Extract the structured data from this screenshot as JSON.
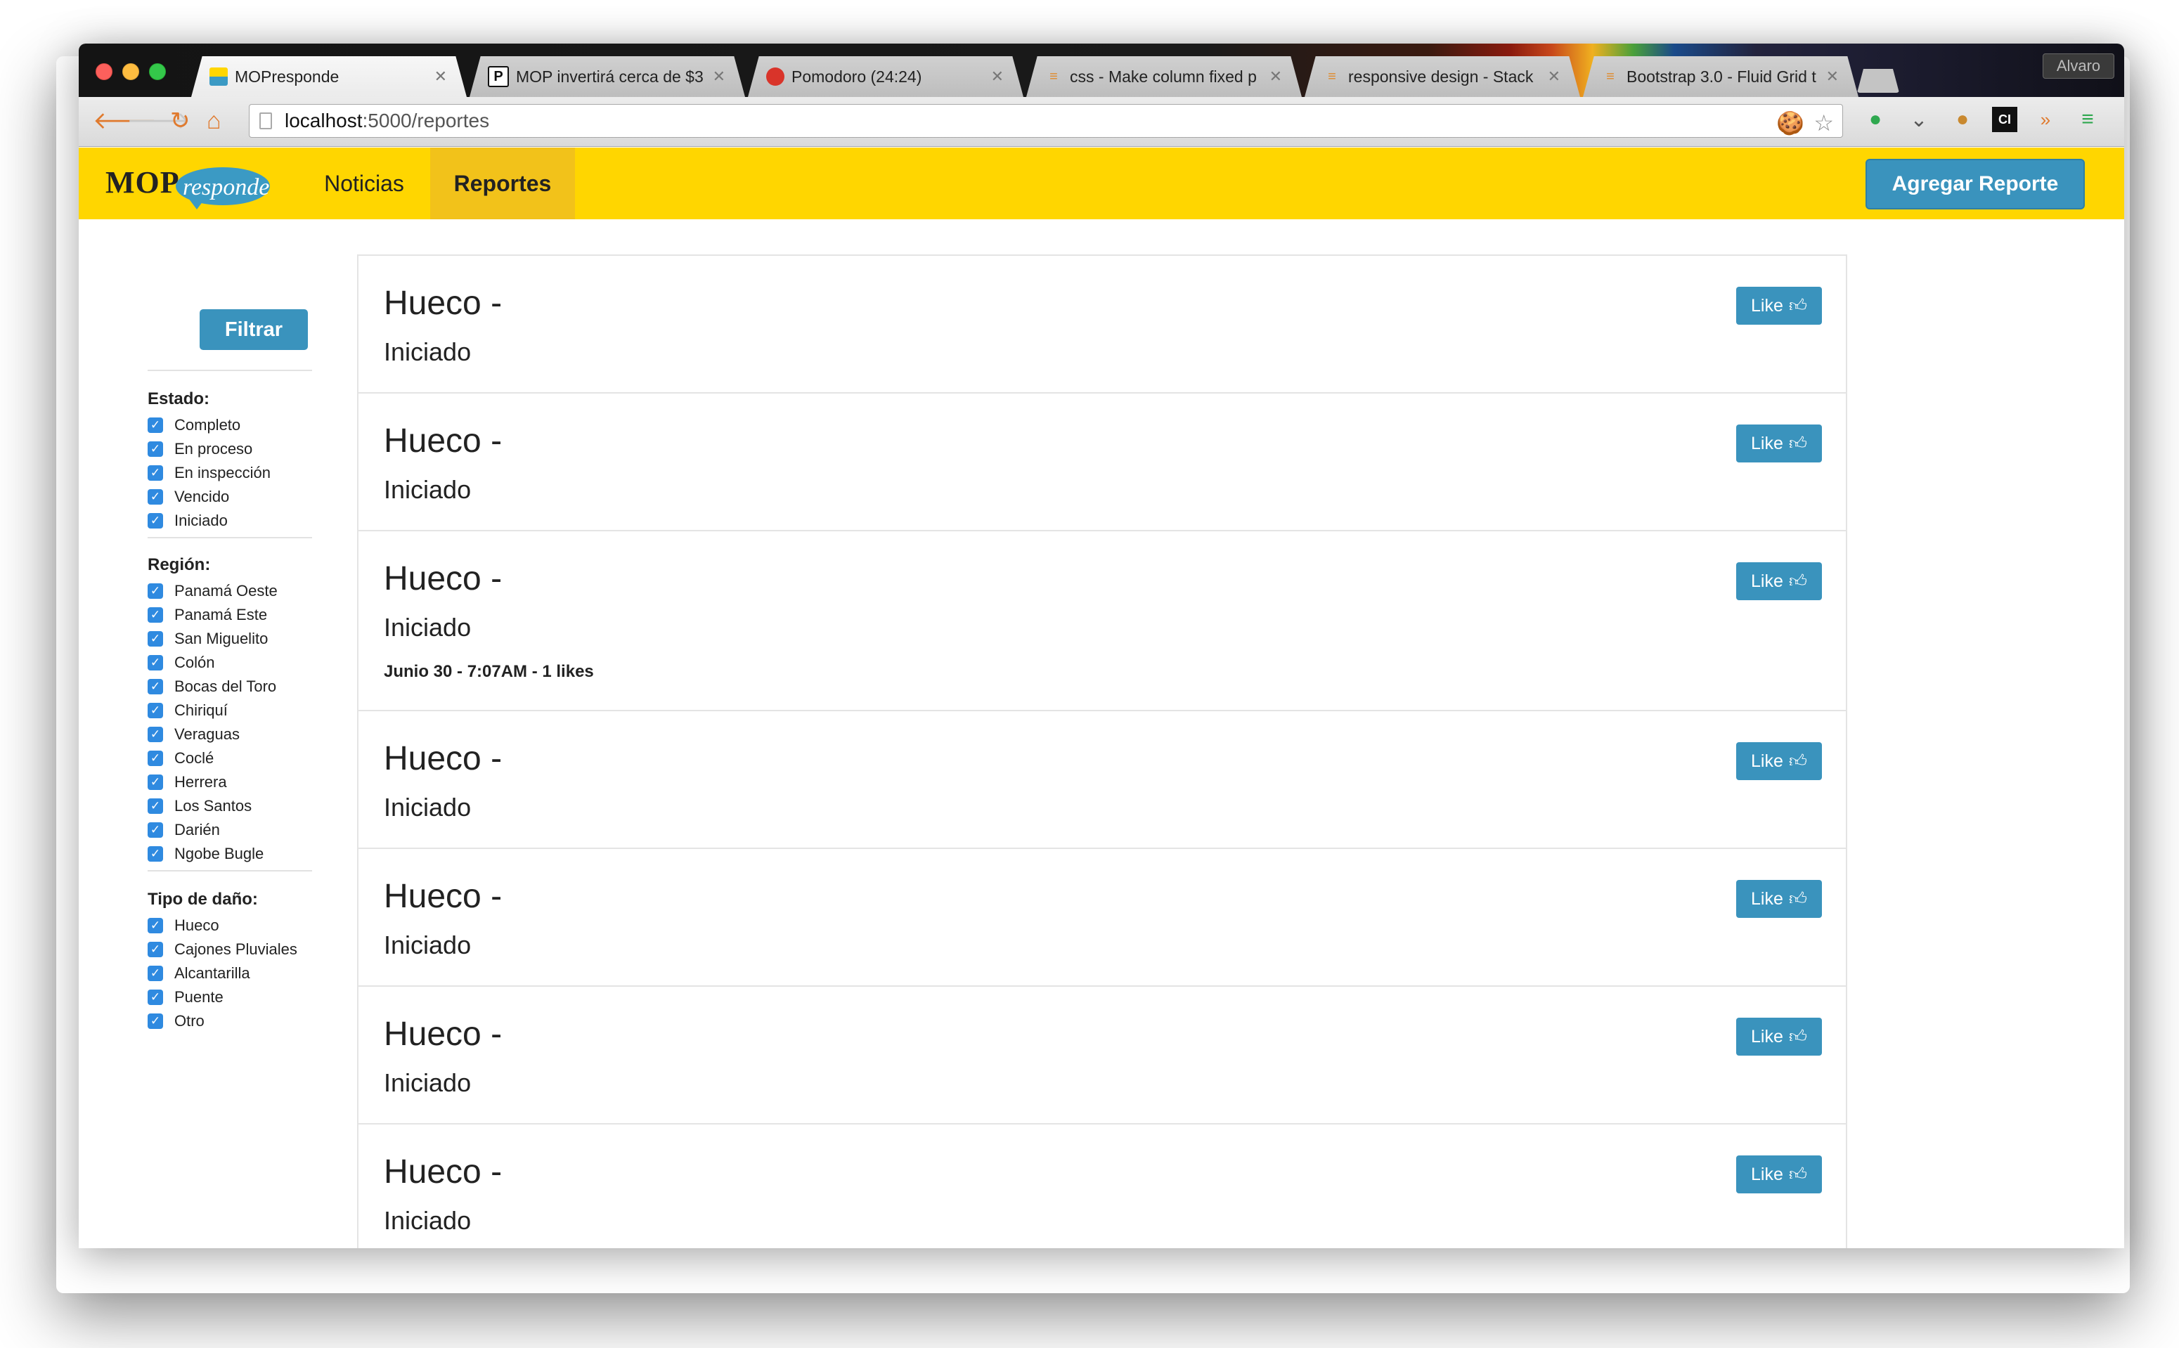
{
  "browser": {
    "tabs": [
      {
        "title": "MOPresponde",
        "favicon": "mop-favicon",
        "active": true
      },
      {
        "title": "MOP invertirá cerca de $3",
        "favicon": "p-favicon",
        "active": false
      },
      {
        "title": "Pomodoro (24:24)",
        "favicon": "tomato-favicon",
        "active": false
      },
      {
        "title": "css - Make column fixed p",
        "favicon": "stackoverflow-favicon",
        "active": false
      },
      {
        "title": "responsive design - Stack",
        "favicon": "stackoverflow-favicon",
        "active": false
      },
      {
        "title": "Bootstrap 3.0 - Fluid Grid t",
        "favicon": "stackoverflow-favicon",
        "active": false
      }
    ],
    "profile_name": "Alvaro",
    "url_host": "localhost",
    "url_path": ":5000/reportes"
  },
  "navbar": {
    "brand_mop": "MOP",
    "brand_responde": "responde",
    "items": [
      {
        "label": "Noticias",
        "active": false
      },
      {
        "label": "Reportes",
        "active": true
      }
    ],
    "add_button": "Agregar Reporte",
    "background": "#ffd600",
    "accent": "#3a93bd"
  },
  "sidebar": {
    "filter_button": "Filtrar",
    "groups": [
      {
        "title": "Estado:",
        "options": [
          "Completo",
          "En proceso",
          "En inspección",
          "Vencido",
          "Iniciado"
        ]
      },
      {
        "title": "Región:",
        "options": [
          "Panamá Oeste",
          "Panamá Este",
          "San Miguelito",
          "Colón",
          "Bocas del Toro",
          "Chiriquí",
          "Veraguas",
          "Coclé",
          "Herrera",
          "Los Santos",
          "Darién",
          "Ngobe Bugle"
        ]
      },
      {
        "title": "Tipo de daño:",
        "options": [
          "Hueco",
          "Cajones Pluviales",
          "Alcantarilla",
          "Puente",
          "Otro"
        ]
      }
    ]
  },
  "reports": [
    {
      "title": "Hueco -",
      "status": "Iniciado",
      "meta": "",
      "like_label": "Like"
    },
    {
      "title": "Hueco -",
      "status": "Iniciado",
      "meta": "",
      "like_label": "Like"
    },
    {
      "title": "Hueco -",
      "status": "Iniciado",
      "meta": "Junio 30 - 7:07AM - 1 likes",
      "like_label": "Like"
    },
    {
      "title": "Hueco -",
      "status": "Iniciado",
      "meta": "",
      "like_label": "Like"
    },
    {
      "title": "Hueco -",
      "status": "Iniciado",
      "meta": "",
      "like_label": "Like"
    },
    {
      "title": "Hueco -",
      "status": "Iniciado",
      "meta": "",
      "like_label": "Like"
    },
    {
      "title": "Hueco -",
      "status": "Iniciado",
      "meta": "",
      "like_label": "Like"
    }
  ]
}
